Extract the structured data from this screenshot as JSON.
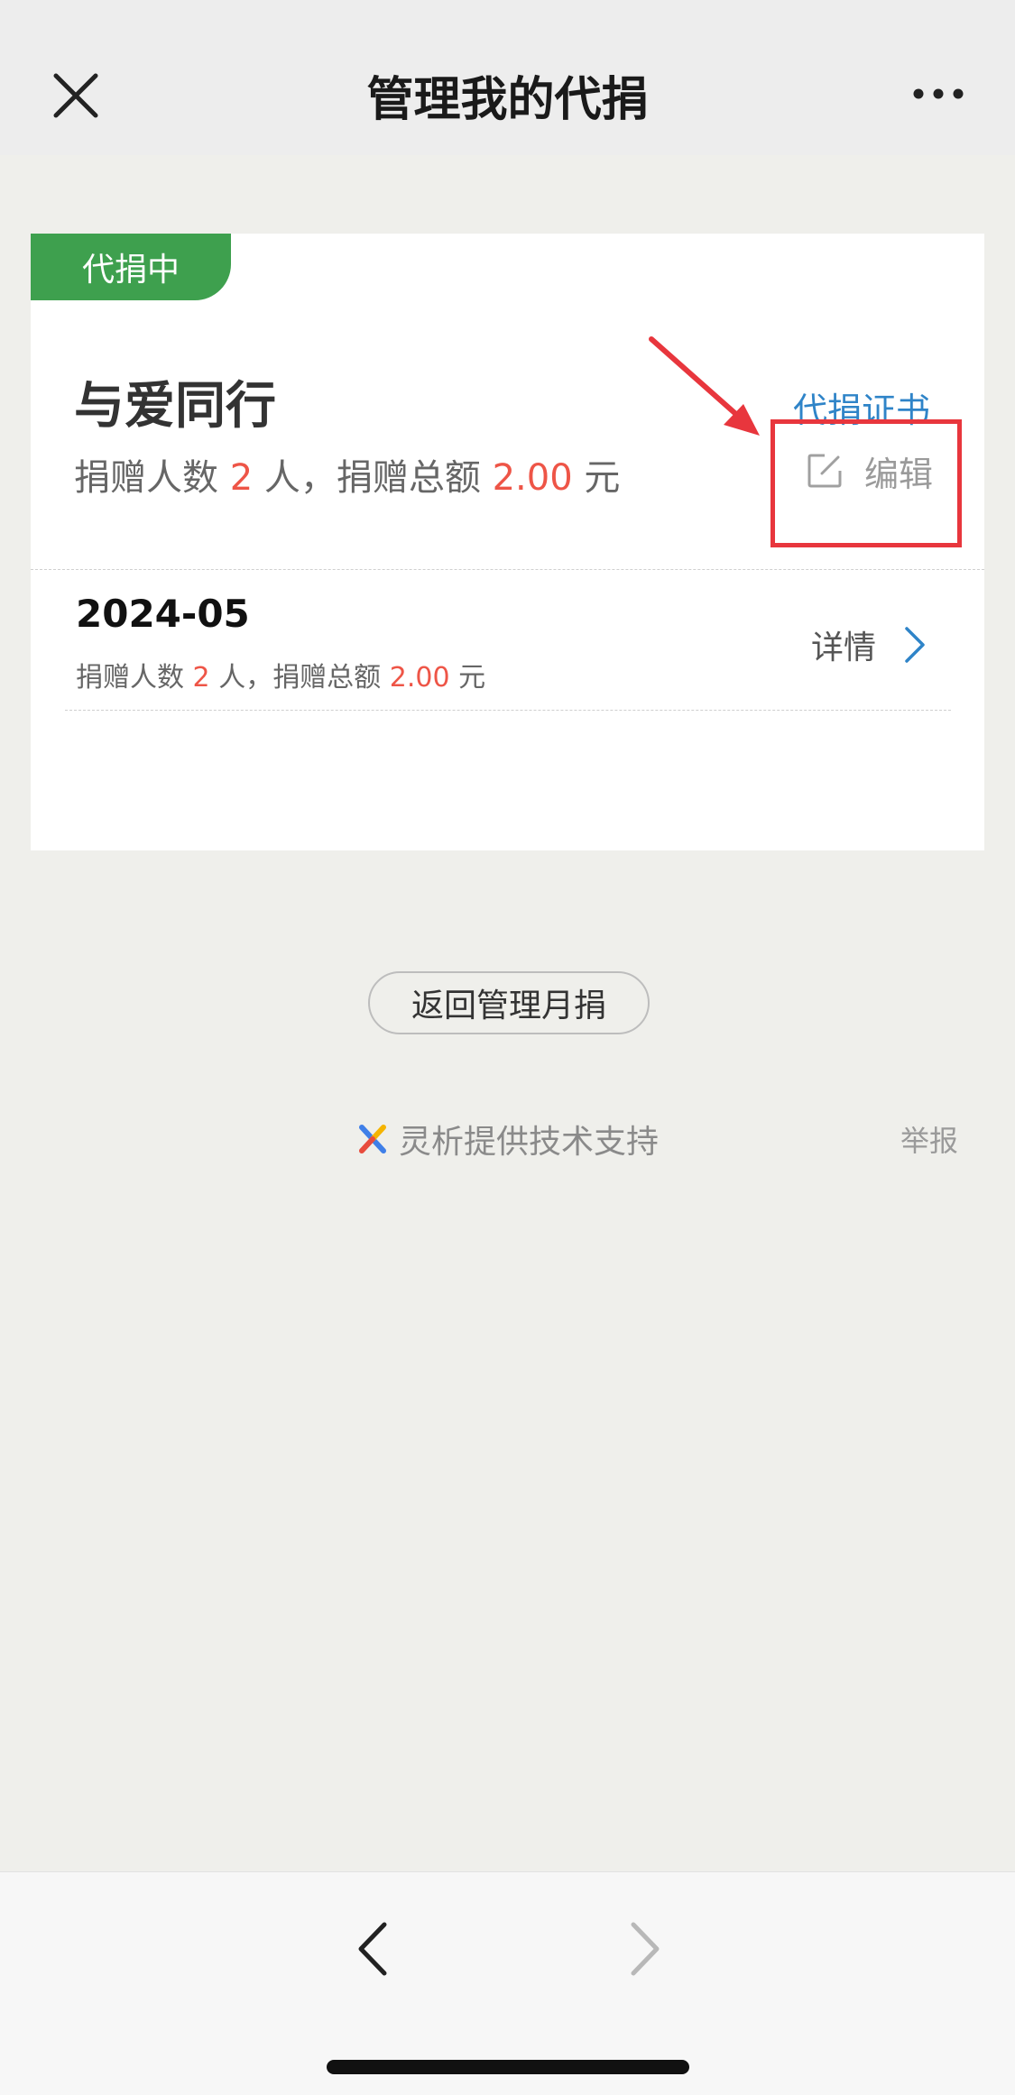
{
  "header": {
    "title": "管理我的代捐",
    "close_icon": "close-icon",
    "more_icon": "more-dots-icon"
  },
  "card": {
    "status_badge": "代捐中",
    "title": "与爱同行",
    "summary": {
      "count_label": "捐赠人数",
      "count": "2",
      "count_unit": "人，",
      "total_label": "捐赠总额",
      "total": "2.00",
      "total_unit": "元"
    },
    "certificate_link": "代捐证书",
    "edit_label": "编辑",
    "record": {
      "month": "2024-05",
      "count_label": "捐赠人数",
      "count": "2",
      "count_unit": "人，",
      "total_label": "捐赠总额",
      "total": "2.00",
      "total_unit": "元",
      "detail_label": "详情"
    }
  },
  "back_button": "返回管理月捐",
  "footer": {
    "provider": "灵析提供技术支持",
    "report": "举报"
  },
  "colors": {
    "accent_green": "#3ea04e",
    "link_blue": "#2f84c8",
    "highlight_red": "#e8363d",
    "amount_red": "#ee5547"
  }
}
